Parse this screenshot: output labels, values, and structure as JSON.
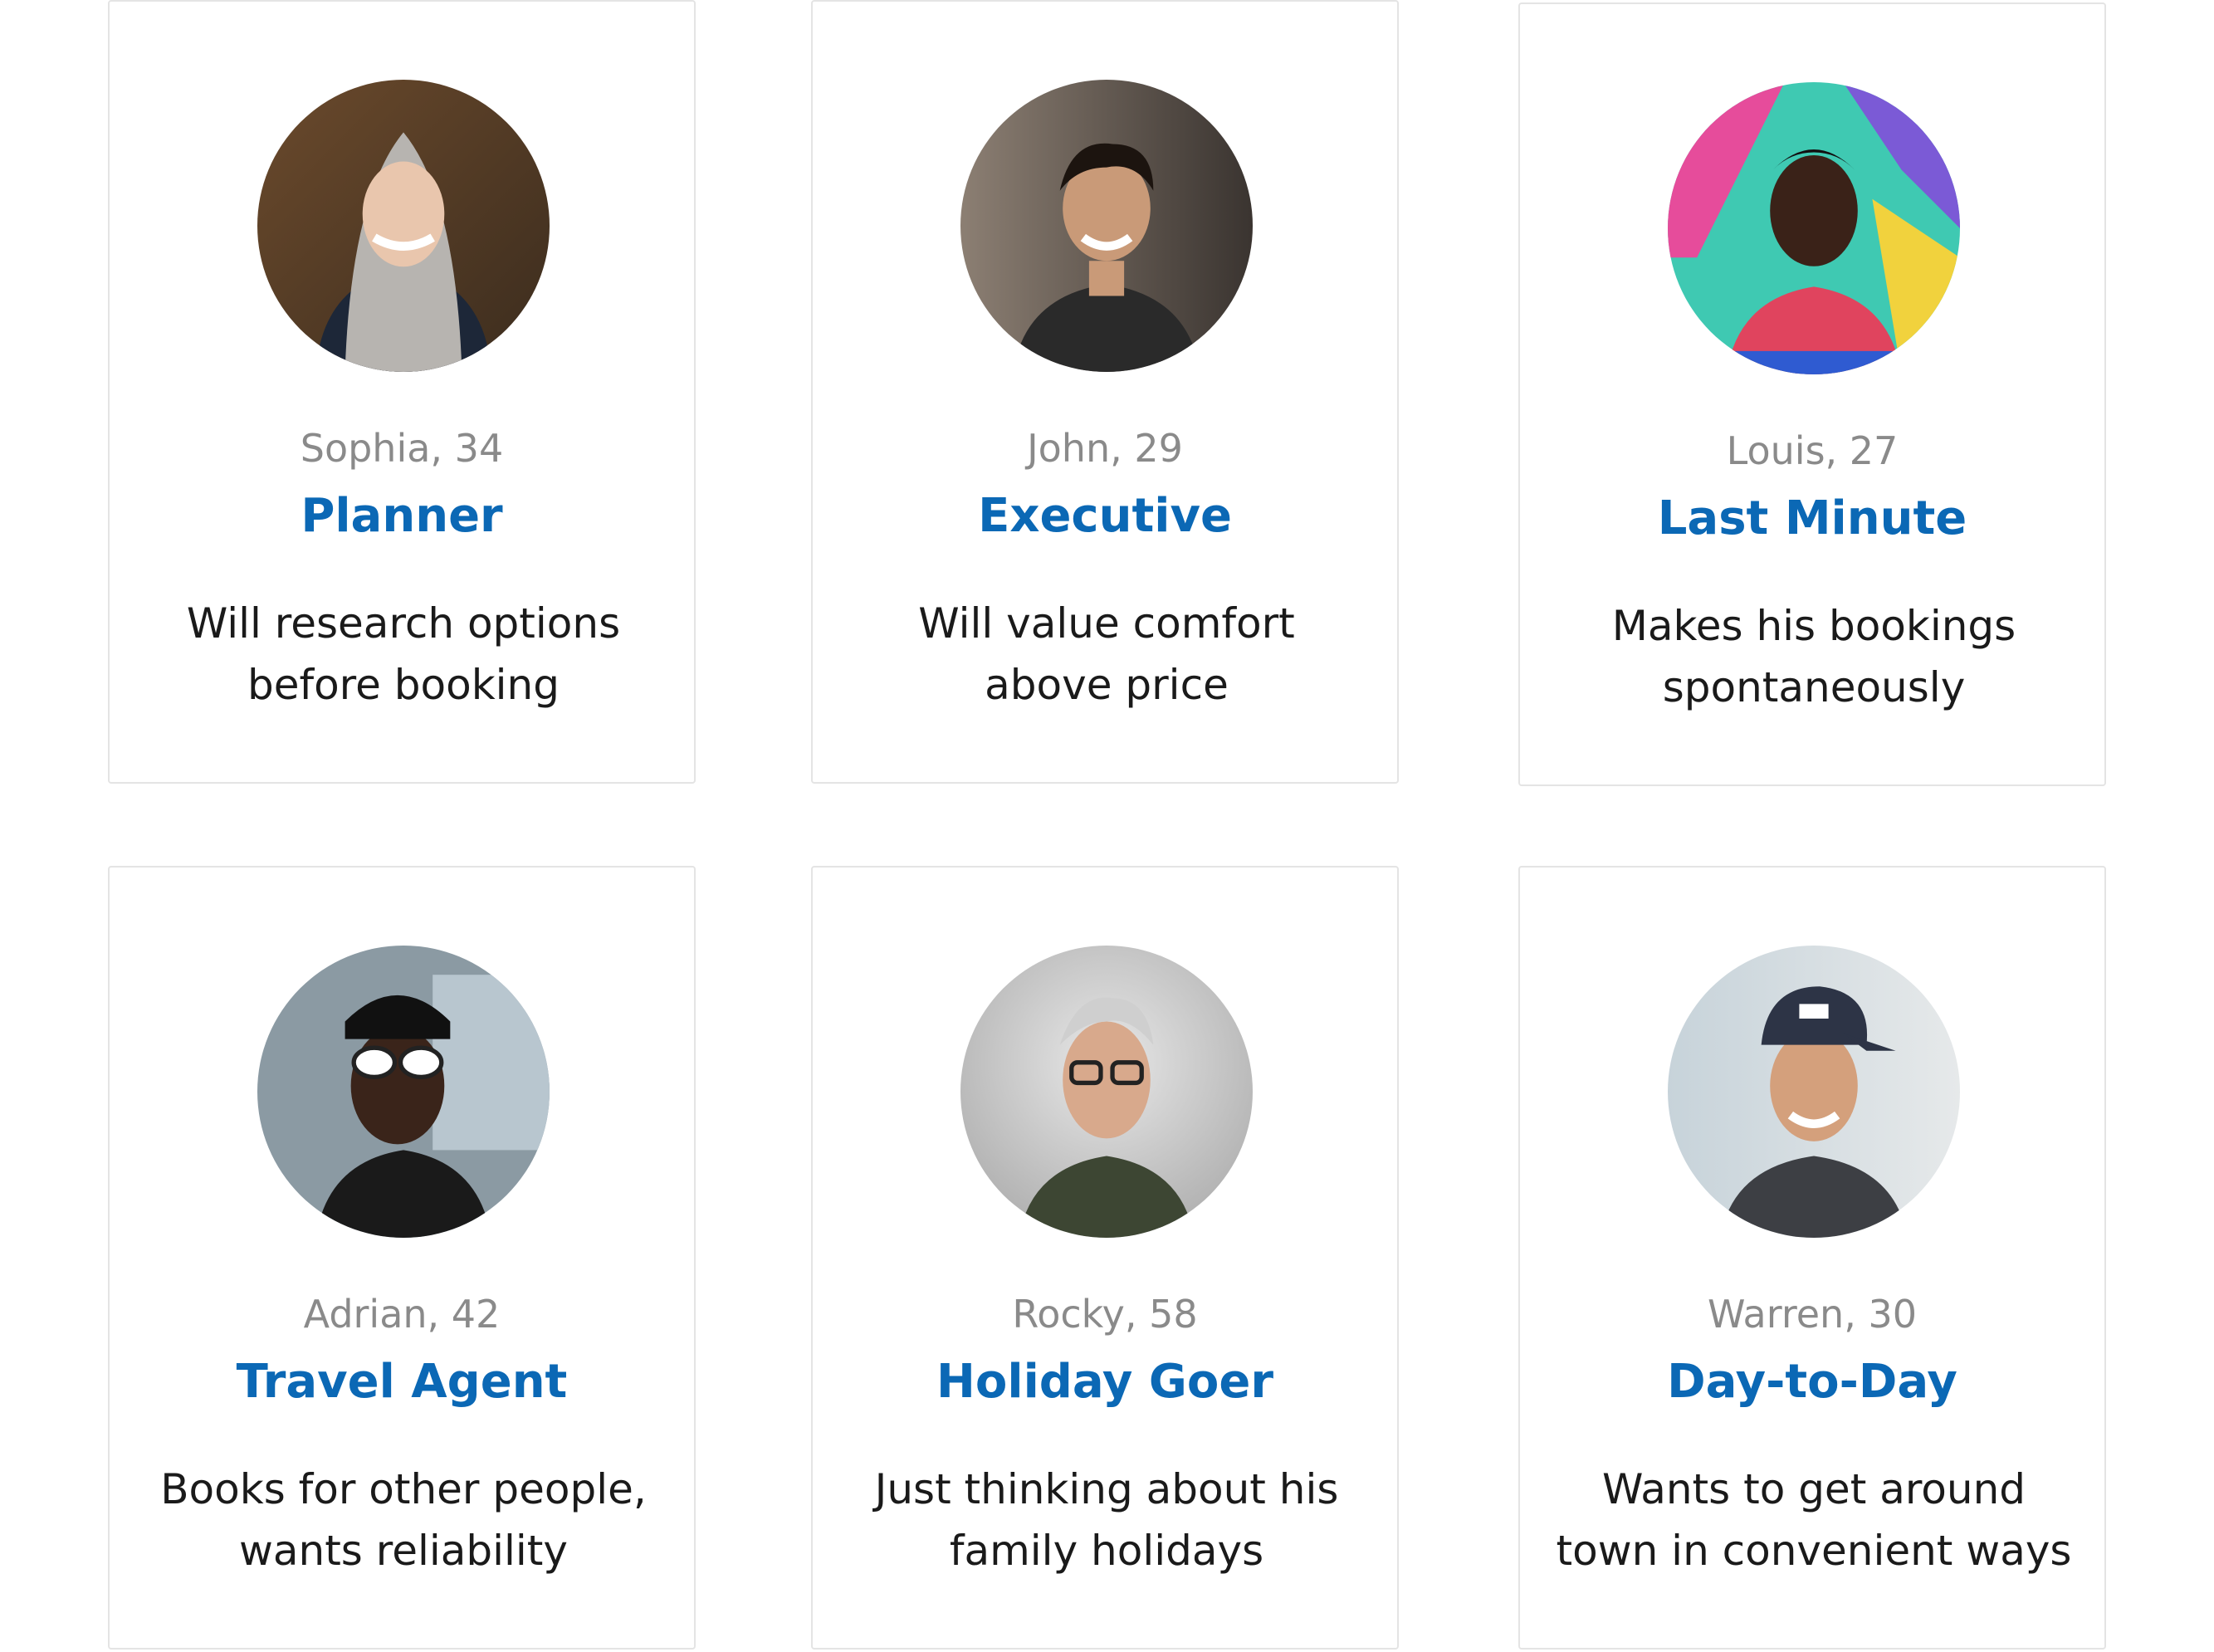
{
  "personas": [
    {
      "name_age": "Sophia, 34",
      "role": "Planner",
      "desc_lines": [
        "Will research options",
        "before booking"
      ],
      "avatar": "person-hooded-woman"
    },
    {
      "name_age": "John, 29",
      "role": "Executive",
      "desc_lines": [
        "Will value comfort",
        "above price"
      ],
      "avatar": "person-young-man"
    },
    {
      "name_age": "Louis, 27",
      "role": "Last Minute",
      "desc_lines": [
        "Makes his bookings",
        "spontaneously"
      ],
      "avatar": "person-man-graffiti"
    },
    {
      "name_age": "Adrian, 42",
      "role": "Travel Agent",
      "desc_lines": [
        "Books for other people,",
        "wants reliability"
      ],
      "avatar": "person-woman-sunglasses"
    },
    {
      "name_age": "Rocky, 58",
      "role": "Holiday Goer",
      "desc_lines": [
        "Just thinking about his",
        "family holidays"
      ],
      "avatar": "person-older-man-glasses"
    },
    {
      "name_age": "Warren, 30",
      "role": "Day-to-Day",
      "desc_lines": [
        "Wants to get around",
        "town in convenient ways"
      ],
      "avatar": "person-man-cap"
    }
  ],
  "colors": {
    "role_accent": "#0b68b5",
    "meta_text": "#8a8a8a",
    "body_text": "#1a1a1a",
    "card_border": "#e4e4e4"
  }
}
